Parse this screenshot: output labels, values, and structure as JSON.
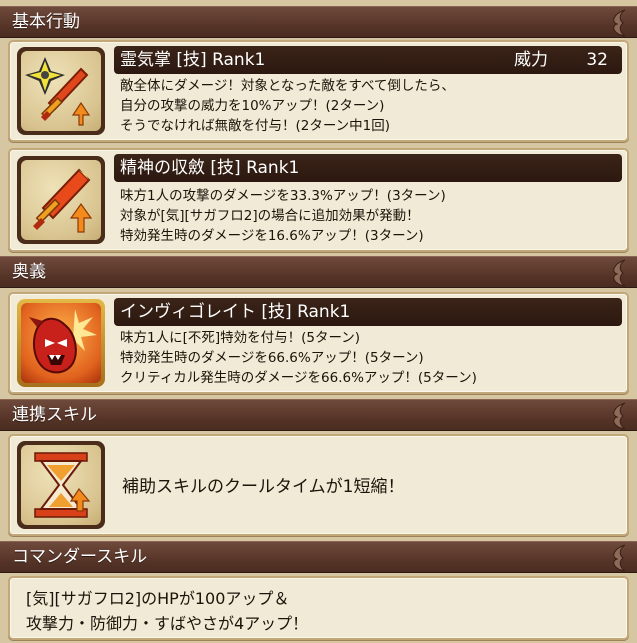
{
  "sections": {
    "basic": {
      "title": "基本行動"
    },
    "ougi": {
      "title": "奥義"
    },
    "link": {
      "title": "連携スキル"
    },
    "commander": {
      "title": "コマンダースキル"
    }
  },
  "skills": [
    {
      "name": "霊気掌 [技]  Rank1",
      "stat_label": "威力",
      "stat_value": "32",
      "icon": "shuriken-sword-icon",
      "lines": [
        "敵全体にダメージ！対象となった敵をすべて倒したら、",
        "自分の攻撃の威力を10%アップ！(2ターン)",
        "そうでなければ無敵を付与！(2ターン中1回)"
      ]
    },
    {
      "name": "精神の収斂 [技]  Rank1",
      "icon": "sword-up-arrow-icon",
      "lines": [
        "味方1人の攻撃のダメージを33.3%アップ！(3ターン)",
        "対象が[気][サガフロ2]の場合に追加効果が発動！",
        "特効発生時のダメージを16.6%アップ！(3ターン)"
      ]
    },
    {
      "name": "インヴィゴレイト [技]  Rank1",
      "icon": "red-demon-face-icon",
      "lines": [
        "味方1人に[不死]特効を付与！(5ターン)",
        "特効発生時のダメージを66.6%アップ！(5ターン)",
        "クリティカル発生時のダメージを66.6%アップ！(5ターン)"
      ]
    }
  ],
  "link_skill": {
    "icon": "hourglass-arrow-icon",
    "text": "補助スキルのクールタイムが1短縮！"
  },
  "commander_skill": {
    "lines": [
      "[気][サガフロ2]のHPが100アップ＆",
      "攻撃力・防御力・すばやさが4アップ！"
    ]
  }
}
